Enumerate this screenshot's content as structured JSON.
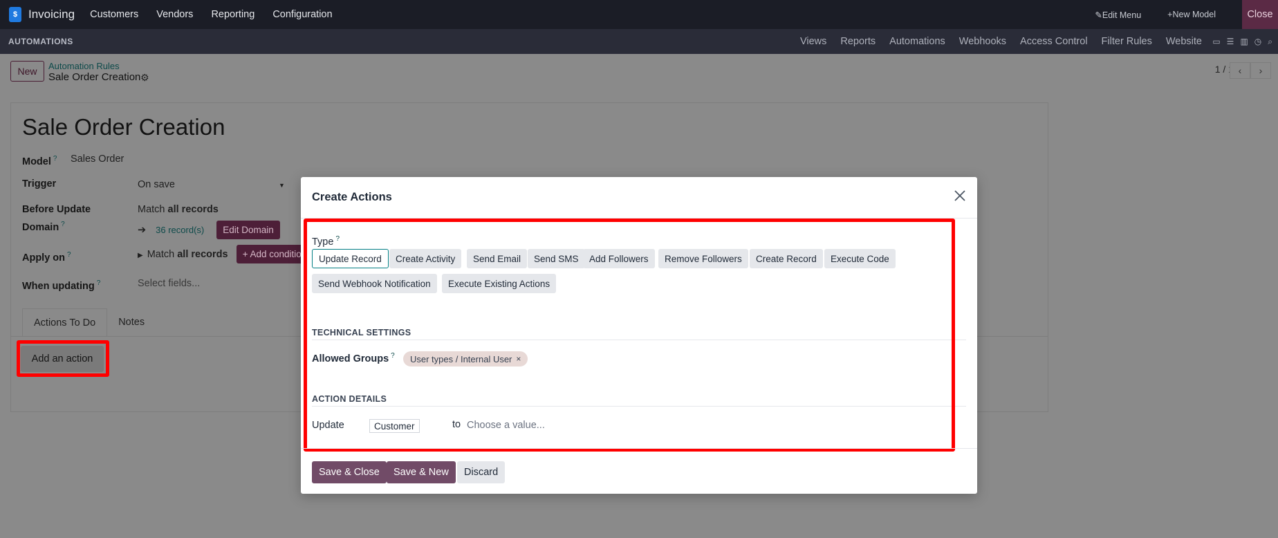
{
  "topbar": {
    "app_name": "Invoicing",
    "menus": [
      "Customers",
      "Vendors",
      "Reporting",
      "Configuration"
    ],
    "edit_menu": "Edit Menu",
    "new_model": "New Model",
    "close": "Close"
  },
  "studio": {
    "title": "AUTOMATIONS",
    "links": [
      "Views",
      "Reports",
      "Automations",
      "Webhooks",
      "Access Control",
      "Filter Rules",
      "Website"
    ]
  },
  "control": {
    "new_label": "New",
    "breadcrumb_parent": "Automation Rules",
    "breadcrumb_current": "Sale Order Creation",
    "pager": "1 / 1"
  },
  "form": {
    "title": "Sale Order Creation",
    "model_label": "Model",
    "model_value": "Sales Order",
    "trigger_label": "Trigger",
    "trigger_value": "On save",
    "before_label_1": "Before Update",
    "before_label_2": "Domain",
    "match_prefix": "Match",
    "match_all": "all records",
    "records_count": "36 record(s)",
    "edit_domain": "Edit Domain",
    "apply_label": "Apply on",
    "add_condition": "Add conditio",
    "when_label": "When updating",
    "when_placeholder": "Select fields...",
    "tabs": [
      "Actions To Do",
      "Notes"
    ],
    "add_action": "Add an action"
  },
  "modal": {
    "title": "Create Actions",
    "type_label": "Type",
    "types_row1": [
      "Update Record",
      "Create Activity",
      "Send Email",
      "Send SMS",
      "Add Followers",
      "Remove Followers",
      "Create Record",
      "Execute Code"
    ],
    "types_row2": [
      "Send Webhook Notification",
      "Execute Existing Actions"
    ],
    "active_type": "Update Record",
    "technical_title": "TECHNICAL SETTINGS",
    "groups_label": "Allowed Groups",
    "group_tag": "User types / Internal User",
    "details_title": "ACTION DETAILS",
    "update_label": "Update",
    "update_field": "Customer",
    "to_label": "to",
    "value_placeholder": "Choose a value...",
    "save_close": "Save & Close",
    "save_new": "Save & New",
    "discard": "Discard"
  },
  "colors": {
    "highlight": "#ff0000",
    "primary": "#714b67",
    "accent_teal": "#017e84"
  }
}
